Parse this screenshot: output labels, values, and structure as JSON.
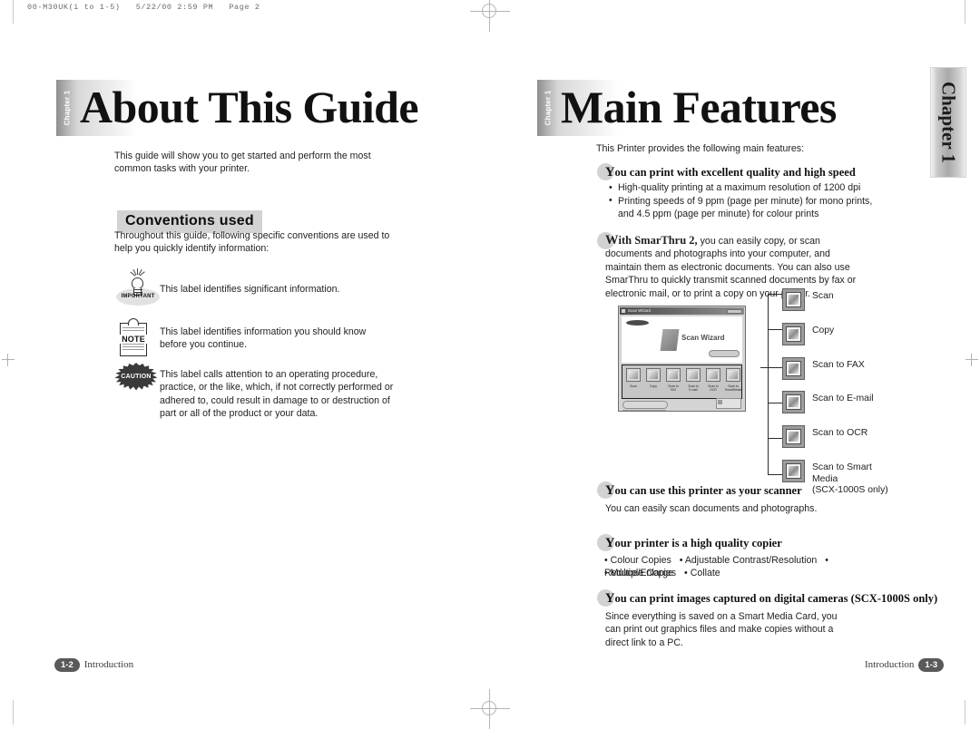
{
  "scan_header": "00-M30UK(i to 1-5)   5/22/00 2:59 PM   Page 2",
  "side_tab": {
    "label": "Chapter 1"
  },
  "left_page": {
    "chapter_tab": "Chapter 1",
    "title": "About This Guide",
    "intro": "This guide will show you to get started and perform the most common tasks with your printer.",
    "section_heading": "Conventions used",
    "section_intro": "Throughout this guide, following specific conventions are used to help you quickly identify information:",
    "conventions": [
      {
        "icon": "important-bulb-icon",
        "icon_label": "IMPORTANT",
        "text": "This label identifies significant information."
      },
      {
        "icon": "note-clipboard-icon",
        "icon_label": "NOTE",
        "text": "This label identifies information you should know before you continue."
      },
      {
        "icon": "caution-starburst-icon",
        "icon_label": "CAUTION",
        "text": "This label calls attention to an operating procedure, practice, or the like, which, if  not correctly performed or adhered to, could result in damage to or destruction of part or all of the product or your data."
      }
    ],
    "footer": {
      "page": "1-2",
      "text": "Introduction"
    }
  },
  "right_page": {
    "chapter_tab": "Chapter 1",
    "title": "Main Features",
    "intro": "This Printer provides the following main features:",
    "features": [
      {
        "dropcap": "Y",
        "heading_rest": "ou can print with excellent quality and high speed",
        "bullets": [
          "High-quality printing at a maximum resolution of 1200 dpi",
          "Printing speeds of 9 ppm (page per minute) for mono prints,"
        ],
        "bullet_continuation": "and 4.5 ppm (page per minute) for colour prints"
      },
      {
        "dropcap": "W",
        "heading_rest": "ith SmarThru 2,",
        "paragraph": "you can easily copy, or scan documents and photographs into your computer, and maintain them as electronic documents. You can also use SmarThru to quickly transmit scanned documents by fax or electronic mail, or to print a copy on your printer."
      },
      {
        "dropcap": "Y",
        "heading_rest": "ou can use this printer as your scanner",
        "paragraph": "You can easily scan documents and photographs."
      },
      {
        "dropcap": "Y",
        "heading_rest": "our printer is a high quality copier",
        "copier_line1": [
          "Colour Copies",
          "Adjustable Contrast/Resolution",
          "Reduce/Enlarge"
        ],
        "copier_line2": [
          "Multiple Copies",
          "Collate"
        ]
      },
      {
        "dropcap": "Y",
        "heading_rest": "ou can print images captured on digital cameras (SCX-1000S only)",
        "paragraph": "Since everything is saved on a Smart Media Card, you can print out graphics files and make copies without a direct link to a PC."
      }
    ],
    "scan_wizard": {
      "window_title": "Scan Wizard",
      "brand": "SAMSUNG",
      "app_title": "Scan Wizard",
      "toolbar_buttons": [
        "Scan",
        "Copy",
        "Scan to FAX",
        "Scan to E-mail",
        "Scan to OCR",
        "Scan to SmartMedia"
      ]
    },
    "callouts": [
      {
        "icon": "scan-icon",
        "label": "Scan"
      },
      {
        "icon": "copy-icon",
        "label": "Copy"
      },
      {
        "icon": "scan-to-fax-icon",
        "label": "Scan to FAX"
      },
      {
        "icon": "scan-to-email-icon",
        "label": "Scan to E-mail"
      },
      {
        "icon": "scan-to-ocr-icon",
        "label": "Scan to OCR"
      },
      {
        "icon": "scan-to-smart-media-icon",
        "label": "Scan to Smart\nMedia\n(SCX-1000S only)"
      }
    ],
    "footer": {
      "text": "Introduction",
      "page": "1-3"
    }
  },
  "colors": {
    "tab_dark": "#8e8e8e",
    "highlight_grey": "#d3d3d3",
    "badge": "#5a5a5a"
  }
}
